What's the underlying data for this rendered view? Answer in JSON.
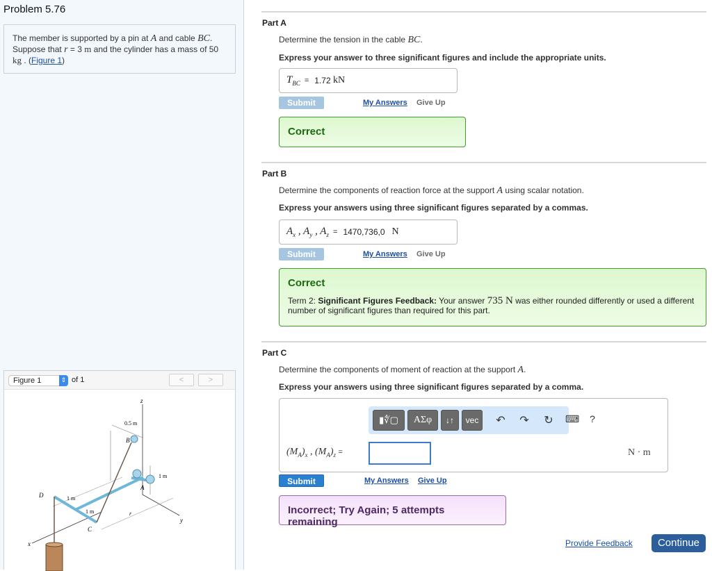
{
  "problem": {
    "title": "Problem 5.76",
    "statement_pre": "The member is supported by a pin at ",
    "point_a": "A",
    "statement_mid": " and cable ",
    "cable": "BC",
    "statement_mid2": ". Suppose that ",
    "var_r": "r",
    "statement_eq": " = 3 ",
    "unit_m": "m",
    "statement_mid3": " and the cylinder has a mass of 50 ",
    "unit_kg": "kg",
    "statement_end": " . (",
    "figure_link": "Figure 1",
    "statement_close": ")"
  },
  "figure_panel": {
    "selected": "Figure 1",
    "of_label": "of 1",
    "prev_label": "<",
    "next_label": ">",
    "labels": {
      "z": "z",
      "y": "y",
      "x": "x",
      "dim_05": "0.5 m",
      "dim_1m_right": "1 m",
      "dim_1m_d": "1 m",
      "dim_1m_c": "1 m",
      "r": "r",
      "A": "A",
      "B": "B",
      "C": "C",
      "D": "D"
    }
  },
  "parts": [
    {
      "label": "Part A",
      "question_pre": "Determine the tension in the cable ",
      "question_math": "BC",
      "question_post": ".",
      "instruction": "Express your answer to three significant figures and include the appropriate units.",
      "answer_lhs": "T",
      "answer_lhs_sub": "BC",
      "answer_value": "1.72",
      "answer_unit": "kN",
      "submit_label": "Submit",
      "my_answers_label": "My Answers",
      "give_up_label": "Give Up",
      "feedback_title": "Correct"
    },
    {
      "label": "Part B",
      "question_pre": "Determine the components of reaction force at the support ",
      "question_math": "A",
      "question_post": " using scalar notation.",
      "instruction": "Express your answers using three significant figures separated by a commas.",
      "answer_lhs": "A_x , A_y , A_z",
      "answer_value": "1470,736,0",
      "answer_unit": "N",
      "submit_label": "Submit",
      "my_answers_label": "My Answers",
      "give_up_label": "Give Up",
      "feedback_title": "Correct",
      "feedback_term": "Term 2: ",
      "feedback_bold": "Significant Figures Feedback:",
      "feedback_pre": " Your answer ",
      "feedback_value": "735 N",
      "feedback_post": " was either rounded differently or used a different number of significant figures than required for this part."
    },
    {
      "label": "Part C",
      "question_pre": "Determine the components of moment of reaction at the support ",
      "question_math": "A",
      "question_post": ".",
      "instruction": "Express your answers using three significant figures separated by a comma.",
      "answer_lhs": "(M_A)_x , (M_A)_z",
      "answer_value": "",
      "answer_unit": "N · m",
      "toolbar": {
        "templates": "▮∜▢",
        "greek": "ΑΣφ",
        "arrows": "↓↑",
        "vec": "vec",
        "undo": "↶",
        "redo": "↷",
        "reset": "↻",
        "keyboard": "⌨",
        "help": "?"
      },
      "submit_label": "Submit",
      "my_answers_label": "My Answers",
      "give_up_label": "Give Up",
      "feedback_incorrect": "Incorrect; Try Again; 5 attempts remaining"
    }
  ],
  "footer": {
    "provide_feedback": "Provide Feedback",
    "continue": "Continue"
  },
  "colors": {
    "link": "#1a4fa3",
    "correct_border": "#3f9b2c",
    "correct_text": "#1b6a0e",
    "incorrect_border": "#9c6aa9",
    "incorrect_text": "#4d2a63",
    "submit_active": "#2b7fd0",
    "submit_disabled": "#a6c5e0",
    "continue": "#2d5e9c"
  }
}
